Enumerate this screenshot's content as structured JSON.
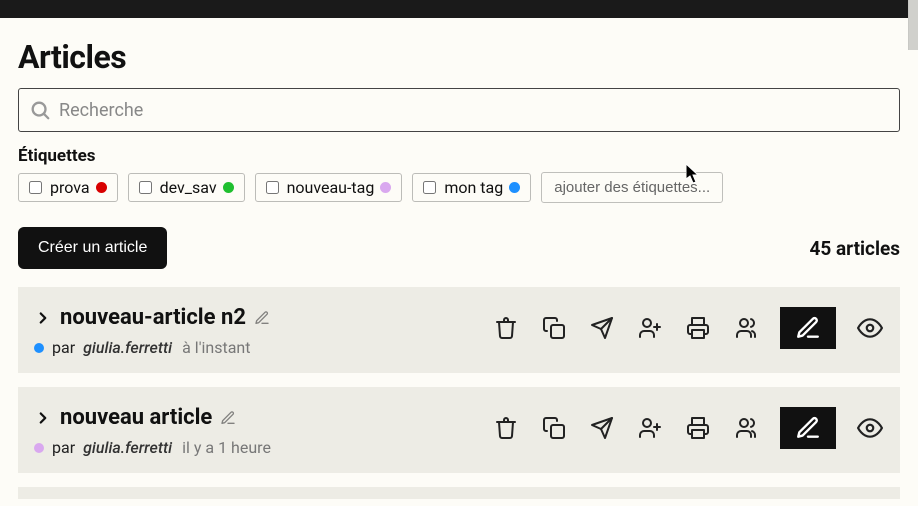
{
  "header": {
    "title": "Articles"
  },
  "search": {
    "placeholder": "Recherche"
  },
  "tags": {
    "section_label": "Étiquettes",
    "items": [
      {
        "label": "prova",
        "color": "#d80000"
      },
      {
        "label": "dev_sav",
        "color": "#1fbf2f"
      },
      {
        "label": "nouveau-tag",
        "color": "#d9a8ef"
      },
      {
        "label": "mon tag",
        "color": "#1e90ff"
      }
    ],
    "add_label": "ajouter des étiquettes..."
  },
  "toolbar": {
    "create_label": "Créer un article",
    "count_text": "45 articles"
  },
  "articles": [
    {
      "title": "nouveau-article n2",
      "dot_color": "#1e90ff",
      "by": "par",
      "author": "giulia.ferretti",
      "time": "à l'instant"
    },
    {
      "title": "nouveau article",
      "dot_color": "#d9a8ef",
      "by": "par",
      "author": "giulia.ferretti",
      "time": "il y a 1 heure"
    }
  ]
}
